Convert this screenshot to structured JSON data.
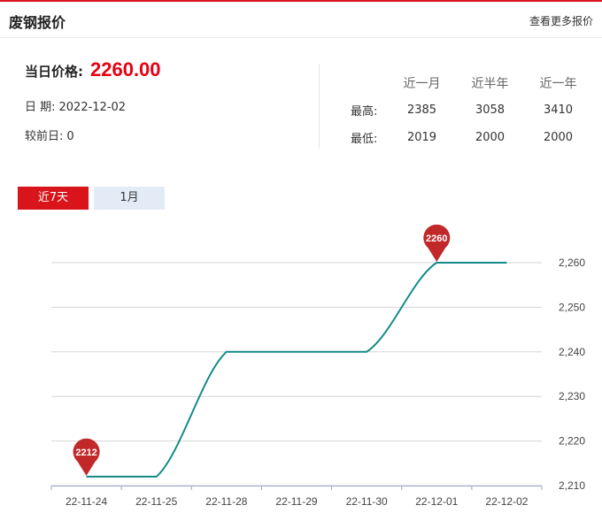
{
  "header": {
    "title": "废钢报价",
    "more_link": "查看更多报价"
  },
  "price": {
    "today_label": "当日价格:",
    "today_value": "2260.00",
    "date_label": "日 期:",
    "date_value": "2022-12-02",
    "change_label": "较前日:",
    "change_value": "0"
  },
  "stats": {
    "headers": [
      "近一月",
      "近半年",
      "近一年"
    ],
    "rows": [
      {
        "label": "最高:",
        "values": [
          "2385",
          "3058",
          "3410"
        ]
      },
      {
        "label": "最低:",
        "values": [
          "2019",
          "2000",
          "2000"
        ]
      }
    ]
  },
  "tabs": [
    {
      "label": "近7天",
      "active": true
    },
    {
      "label": "1月",
      "active": false
    }
  ],
  "colors": {
    "accent": "#d9141b",
    "line": "#138a88",
    "pin": "#c0282a",
    "tab_inactive": "#e3ecf6"
  },
  "chart_data": {
    "type": "line",
    "categories": [
      "22-11-24",
      "22-11-25",
      "22-11-28",
      "22-11-29",
      "22-11-30",
      "22-12-01",
      "22-12-02"
    ],
    "x_points": [
      "22-11-24",
      "22-11-25",
      "22-11-28",
      "22-11-29",
      "22-11-30",
      "22-12-01",
      "22-12-02"
    ],
    "values": [
      2212,
      2212,
      2240,
      2240,
      2240,
      2260,
      2260
    ],
    "ylim": [
      2210,
      2260
    ],
    "yticks": [
      2210,
      2220,
      2230,
      2240,
      2250,
      2260
    ],
    "ytick_labels": [
      "2,210",
      "2,220",
      "2,230",
      "2,240",
      "2,250",
      "2,260"
    ],
    "annotations": [
      {
        "category": "22-11-24",
        "value": 2212,
        "text": "2212"
      },
      {
        "category": "22-12-01",
        "value": 2260,
        "text": "2260"
      }
    ],
    "grid": true,
    "smooth": true
  }
}
